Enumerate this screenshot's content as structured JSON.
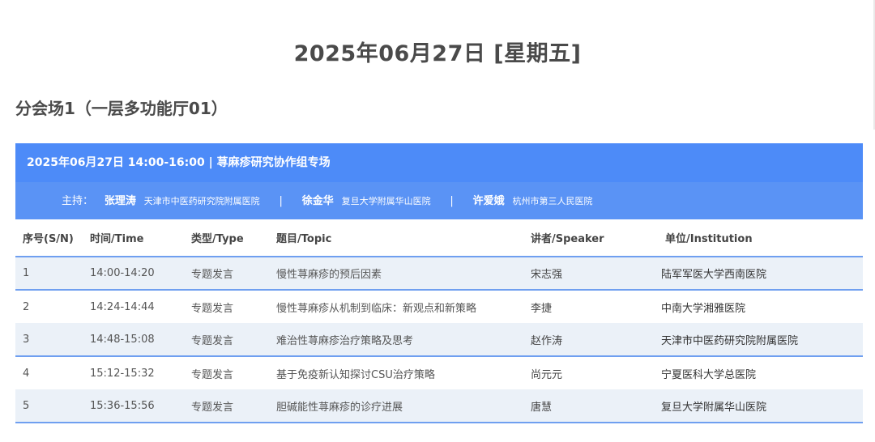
{
  "date_title": "2025年06月27日 [星期五]",
  "venue_title": "分会场1（一层多功能厅01）",
  "session": {
    "header": "2025年06月27日 14:00-16:00 | 荨麻疹研究协作组专场",
    "hosts_label": "主持：",
    "hosts": [
      {
        "name": "张理涛",
        "institution": "天津市中医药研究院附属医院"
      },
      {
        "name": "徐金华",
        "institution": "复旦大学附属华山医院"
      },
      {
        "name": "许爱娥",
        "institution": "杭州市第三人民医院"
      }
    ],
    "separator": "|"
  },
  "table": {
    "headers": [
      "序号(S/N)",
      "时间/Time",
      "类型/Type",
      "题目/Topic",
      "讲者/Speaker",
      "单位/Institution"
    ],
    "rows": [
      [
        "1",
        "14:00-14:20",
        "专题发言",
        "慢性荨麻疹的预后因素",
        "宋志强",
        "陆军军医大学西南医院"
      ],
      [
        "2",
        "14:24-14:44",
        "专题发言",
        "慢性荨麻疹从机制到临床：新观点和新策略",
        "李捷",
        "中南大学湘雅医院"
      ],
      [
        "3",
        "14:48-15:08",
        "专题发言",
        "难治性荨麻疹治疗策略及思考",
        "赵作涛",
        "天津市中医药研究院附属医院"
      ],
      [
        "4",
        "15:12-15:32",
        "专题发言",
        "基于免疫新认知探讨CSU治疗策略",
        "尚元元",
        "宁夏医科大学总医院"
      ],
      [
        "5",
        "15:36-15:56",
        "专题发言",
        "胆碱能性荨麻疹的诊疗进展",
        "唐慧",
        "复旦大学附属华山医院"
      ]
    ]
  },
  "colors": {
    "header_blue": "#4d8bf8",
    "row_alt": "#ebf1f8",
    "divider": "#6f9ff0"
  }
}
